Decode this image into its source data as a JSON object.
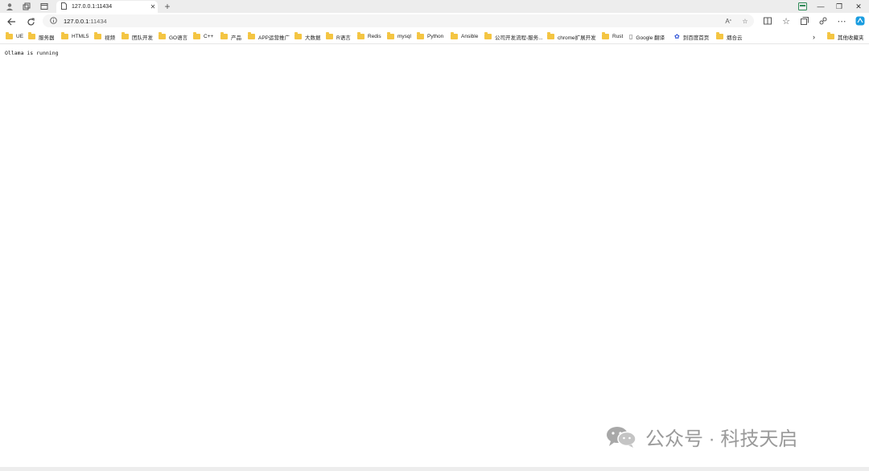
{
  "tab": {
    "title": "127.0.0.1:11434"
  },
  "address": {
    "host": "127.0.0.1",
    "port": ":11434"
  },
  "bookmarks": [
    {
      "label": "UE",
      "icon": "folder-icon"
    },
    {
      "label": "服务器",
      "icon": "folder-icon"
    },
    {
      "label": "HTML5",
      "icon": "folder-icon"
    },
    {
      "label": "视频",
      "icon": "folder-icon"
    },
    {
      "label": "团队开发",
      "icon": "folder-icon"
    },
    {
      "label": "GO语言",
      "icon": "folder-icon"
    },
    {
      "label": "C++",
      "icon": "folder-icon"
    },
    {
      "label": "产品",
      "icon": "folder-icon"
    },
    {
      "label": "APP运营推广",
      "icon": "folder-icon"
    },
    {
      "label": "大数据",
      "icon": "folder-icon"
    },
    {
      "label": "R语言",
      "icon": "folder-icon"
    },
    {
      "label": "Redis",
      "icon": "folder-icon"
    },
    {
      "label": "mysql",
      "icon": "folder-icon"
    },
    {
      "label": "Python",
      "icon": "folder-icon"
    },
    {
      "label": "Ansible",
      "icon": "folder-icon"
    },
    {
      "label": "公司开发流程-服务...",
      "icon": "folder-icon"
    },
    {
      "label": "chrome扩展开发",
      "icon": "folder-icon"
    },
    {
      "label": "Rust",
      "icon": "folder-icon"
    },
    {
      "label": "Google 翻译",
      "icon": "page-icon"
    },
    {
      "label": "到百度首页",
      "icon": "baidu-icon"
    },
    {
      "label": "烟合云",
      "icon": "folder-icon"
    }
  ],
  "other_bookmarks": {
    "label": "其他收藏夹"
  },
  "page": {
    "text": "Ollama is running"
  },
  "watermark": {
    "text": "公众号 · 科技天启"
  }
}
